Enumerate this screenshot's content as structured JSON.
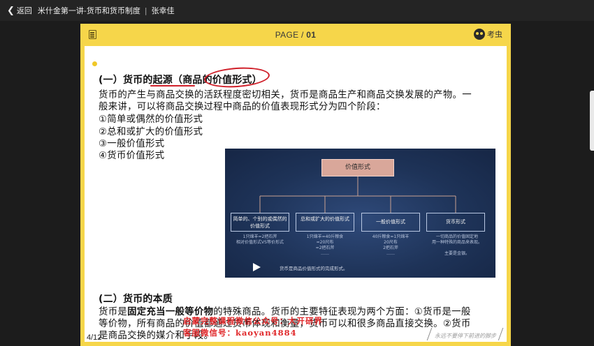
{
  "topbar": {
    "back_label": "返回",
    "course_title": "米什金第一讲-货币和货币制度",
    "separator": "|",
    "teacher": "张幸佳"
  },
  "slide": {
    "page_prefix": "PAGE / ",
    "page_number": "01",
    "brand": "考虫",
    "heading1": "(一）货币的起源（商品的价值形式）",
    "para1_line1": "货币的产生与商品交换的活跃程度密切相关，货币是商品生产和商品交换发展的产物。一",
    "para1_line2": "般来讲，可以将商品交换过程中商品的价值表现形式分为四个阶段：",
    "stages": [
      "①简单或偶然的价值形式",
      "②总和或扩大的价值形式",
      "③一般价值形式",
      "④货币价值形式"
    ],
    "diagram": {
      "root": "价值形式",
      "nodes": [
        {
          "title": "简单的、个别的或偶然的价值形式",
          "note": [
            "1只绵羊=2把石斧",
            "相对价值形式VS等价形式"
          ]
        },
        {
          "title": "总和或扩大的价值形式",
          "note": [
            "1只绵羊=40斤粮食",
            "=20尺布",
            "=2把石斧",
            "……"
          ]
        },
        {
          "title": "一般价值形式",
          "note": [
            "40斤粮食=1只绵羊",
            "20尺布",
            "2把石斧",
            "……"
          ]
        },
        {
          "title": "货币形式",
          "note": [
            "一切商品的价值固定地",
            "用一种特殊的商品来表现。",
            "",
            "主要是金银。"
          ]
        }
      ],
      "caption": "货币是商品价值形式的完成形式。"
    },
    "heading2": "(二）货币的本质",
    "para2_line1_a": "货币是",
    "para2_line1_b": "固定充当一般等价物",
    "para2_line1_c": "的特殊商品。货币的主要特征表现为两个方面：①货币是一般",
    "para2_line2": "等价物，所有商品的价值都通过货币体现和衡量，货币可以和很多商品直接交换。②货币",
    "para2_line3": "是商品交换的媒介和手段。"
  },
  "watermark": {
    "line1": "启蒙完整课程微信公众号：大开研界",
    "line2": "客服微信号：kaoyan4884"
  },
  "pager": "4/12",
  "tagline": "永远不要停下前进的脚步",
  "colors": {
    "accent_yellow": "#f6d64a",
    "annotation_red": "#d0202a",
    "diagram_bg": "#1e3358"
  }
}
